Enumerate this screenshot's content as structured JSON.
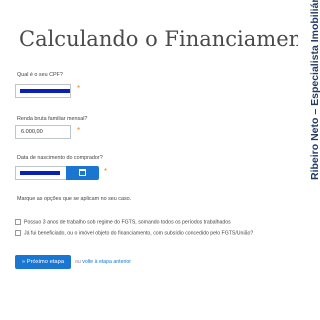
{
  "title": "Calculando o Financiamento",
  "side_caption": "Ribeiro Neto – Especialista Imobiliário",
  "form": {
    "cpf_label": "Qual é o seu CPF?",
    "income_label": "Renda bruta familiar mensal?",
    "income_value": "6.000,00",
    "birthdate_label": "Data de nascimento do comprador?",
    "options_label": "Marque as opções que se aplicam no seu caso.",
    "required_marker": "*",
    "options": [
      "Possuo 3 anos de trabalho sob regime do FGTS, somando todos os períodos trabalhados",
      "Já fui beneficiado, ou o imóvel objeto do financiamento, com subsídio concedido pelo FGTS/União?"
    ],
    "next_button": "» Próximo etapa",
    "or_text": "ou",
    "back_link": "volte à etapa anterior"
  },
  "colors": {
    "mask": "#0a1eb8",
    "accent": "#1b76d2",
    "required": "#e08a1e",
    "side_caption": "#1f3b63"
  }
}
